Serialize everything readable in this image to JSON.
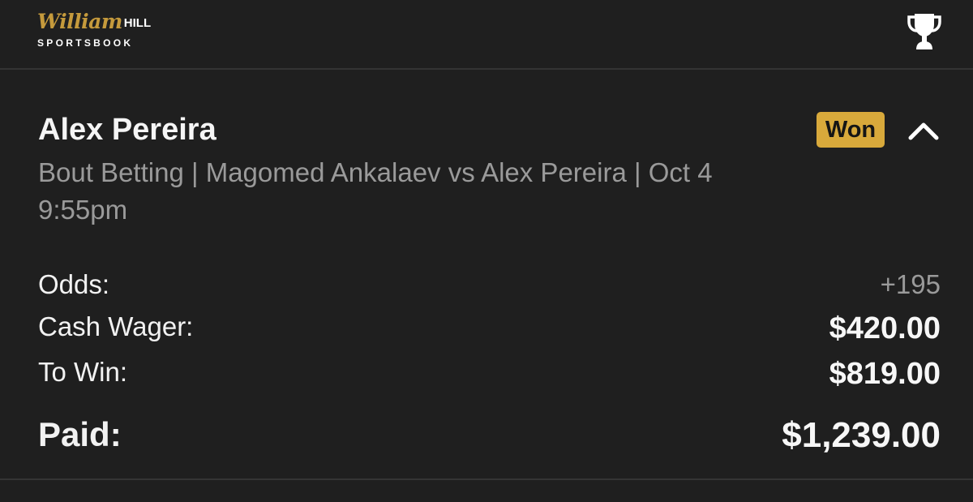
{
  "header": {
    "logo": {
      "script": "William",
      "hill": "HILL",
      "subtitle": "SPORTSBOOK"
    },
    "trophy_icon": "trophy-icon"
  },
  "bet": {
    "selection": "Alex Pereira",
    "description": "Bout Betting | Magomed Ankalaev vs Alex Pereira | Oct 4 9:55pm",
    "status": "Won",
    "status_color": "#d8a93b",
    "collapse_icon": "chevron-up-icon",
    "odds_label": "Odds:",
    "odds_value": "+195",
    "wager_label": "Cash Wager:",
    "wager_value": "$420.00",
    "to_win_label": "To Win:",
    "to_win_value": "$819.00",
    "paid_label": "Paid:",
    "paid_value": "$1,239.00"
  }
}
